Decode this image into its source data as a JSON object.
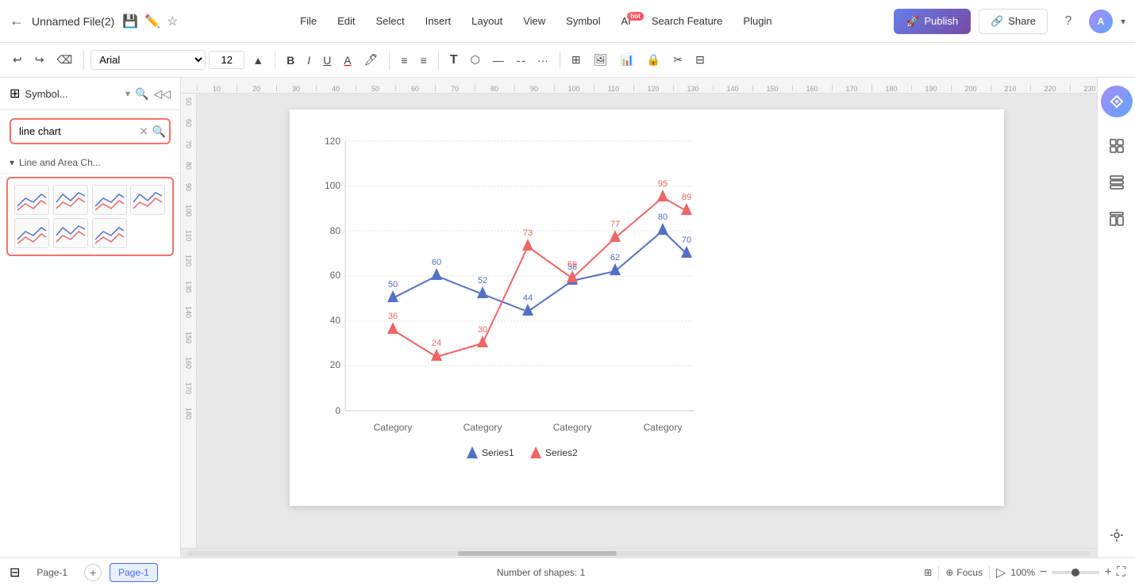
{
  "titleBar": {
    "fileName": "Unnamed File(2)",
    "backLabel": "←",
    "saveLabel": "💾",
    "editLabel": "✏️",
    "starLabel": "☆",
    "publishLabel": "Publish",
    "shareLabel": "Share",
    "helpLabel": "?",
    "avatarLabel": "A",
    "chevronLabel": "▾"
  },
  "menuBar": {
    "items": [
      {
        "label": "File",
        "key": "file"
      },
      {
        "label": "Edit",
        "key": "edit"
      },
      {
        "label": "Select",
        "key": "select"
      },
      {
        "label": "Insert",
        "key": "insert"
      },
      {
        "label": "Layout",
        "key": "layout"
      },
      {
        "label": "View",
        "key": "view"
      },
      {
        "label": "Symbol",
        "key": "symbol"
      },
      {
        "label": "AI",
        "key": "ai",
        "badge": "hot"
      },
      {
        "label": "Search Feature",
        "key": "search-feature"
      },
      {
        "label": "Plugin",
        "key": "plugin"
      }
    ]
  },
  "toolbar": {
    "undoLabel": "↩",
    "redoLabel": "↪",
    "formatLabel": "⌫",
    "fontFamily": "Arial",
    "fontSize": "12",
    "boldLabel": "B",
    "italicLabel": "I",
    "underlineLabel": "U",
    "fontColorLabel": "A",
    "fillColorLabel": "🪣",
    "alignLeftLabel": "≡",
    "alignCenterLabel": "≡",
    "textLabel": "T",
    "shapeLabel": "⬡",
    "lineColorLabel": "—",
    "lineStyleLabel": "—"
  },
  "leftPanel": {
    "title": "Symbol...",
    "searchPlaceholder": "line chart",
    "searchValue": "line chart",
    "sectionLabel": "Line and Area Ch...",
    "chartThumbs": [
      {
        "id": "t1"
      },
      {
        "id": "t2"
      },
      {
        "id": "t3"
      },
      {
        "id": "t4"
      },
      {
        "id": "t5"
      },
      {
        "id": "t6"
      },
      {
        "id": "t7"
      }
    ]
  },
  "chart": {
    "title": "",
    "yAxisMax": 120,
    "yAxisMin": 0,
    "yAxisStep": 20,
    "xCategories": [
      "Category",
      "Category",
      "Category",
      "Category"
    ],
    "series1": {
      "name": "Series1",
      "color": "#5470c6",
      "data": [
        50,
        60,
        52,
        44,
        58,
        62,
        80,
        70
      ]
    },
    "series2": {
      "name": "Series2",
      "color": "#ee6666",
      "data": [
        36,
        24,
        30,
        73,
        59,
        77,
        95,
        89
      ]
    },
    "dataLabels1": [
      "50",
      "60",
      "52",
      "44",
      "58",
      "62",
      "80",
      "70"
    ],
    "dataLabels2": [
      "36",
      "24",
      "30",
      "73",
      "59",
      "77",
      "95",
      "89"
    ]
  },
  "bottomBar": {
    "pageLabel": "Page-1",
    "activePageLabel": "Page-1",
    "addPageLabel": "+",
    "shapesCount": "Number of shapes: 1",
    "layersLabel": "⊞",
    "focusLabel": "Focus",
    "zoomLevel": "100%",
    "zoomOutLabel": "−",
    "zoomInLabel": "+",
    "fullscreenLabel": "⛶"
  },
  "rightSidebar": {
    "icons": [
      {
        "label": "style-panel",
        "symbol": "◈"
      },
      {
        "label": "data-panel",
        "symbol": "⊟"
      },
      {
        "label": "layout-panel",
        "symbol": "⊞"
      }
    ]
  },
  "accentColor": "#f97068",
  "brandBlue": "#5470c6",
  "brandRed": "#ee6666"
}
